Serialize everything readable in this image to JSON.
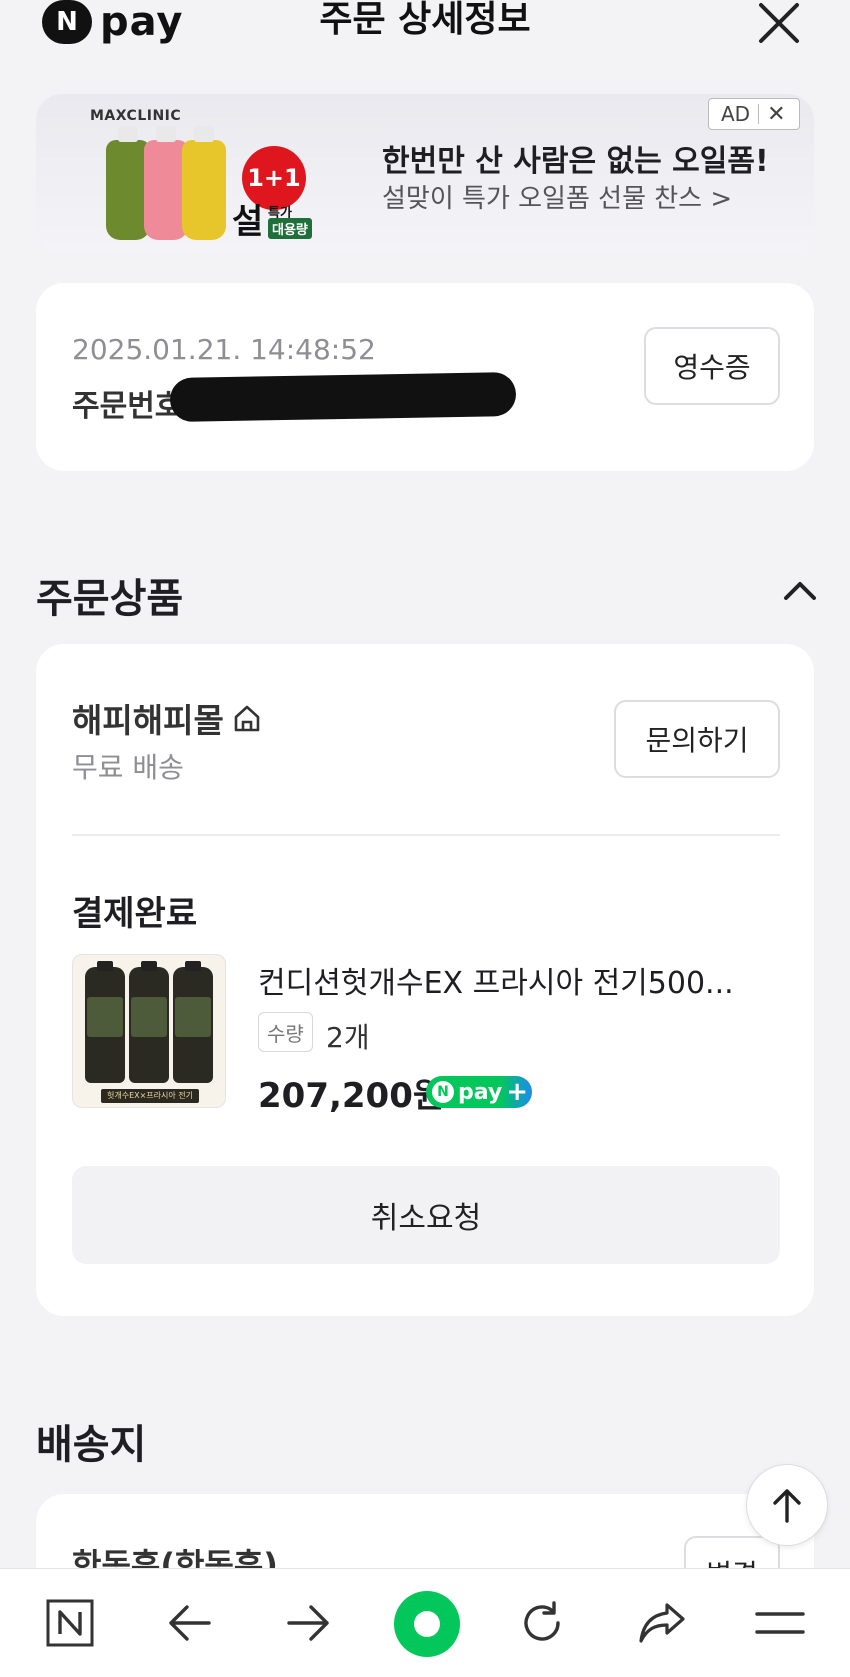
{
  "header": {
    "logo_letter": "N",
    "logo_text": "pay",
    "title": "주문 상세정보",
    "close_icon": "close-icon"
  },
  "ad": {
    "brand": "MAXCLINIC",
    "badge": "1+1",
    "badge_big": "설",
    "badge_tag_top": "특가",
    "badge_tag_bottom": "대용량",
    "title": "한번만 산 사람은 없는 오일폼!",
    "subtitle": "설맞이 특가 오일폼 선물 찬스 >",
    "label": "AD",
    "label_close": "✕"
  },
  "order": {
    "datetime": "2025.01.21. 14:48:52",
    "number_label": "주문번호",
    "receipt_button": "영수증"
  },
  "products_section": {
    "title": "주문상품",
    "store": {
      "name": "해피해피몰",
      "shipping": "무료 배송",
      "inquiry_button": "문의하기"
    },
    "status": "결제완료",
    "item": {
      "name": "컨디션헛개수EX 프라시아 전기500...",
      "qty_label": "수량",
      "qty_value": "2개",
      "price": "207,200원",
      "npay_badge_text": "pay",
      "npay_badge_letter": "N",
      "npay_badge_plus": "+",
      "thumb_caption": "헛개수EX×프라시아 전기"
    },
    "cancel_button": "취소요청"
  },
  "address_section": {
    "title": "배송지",
    "recipient": "한동훈(한동훈)",
    "change_button": "변경"
  },
  "bottom_nav": {
    "items": [
      "n-icon",
      "back-arrow-icon",
      "forward-arrow-icon",
      "home-icon",
      "refresh-icon",
      "share-icon",
      "menu-icon"
    ]
  },
  "colors": {
    "accent_green": "#03c75a",
    "background": "#f3f3f6",
    "ad_red": "#e0161e"
  }
}
